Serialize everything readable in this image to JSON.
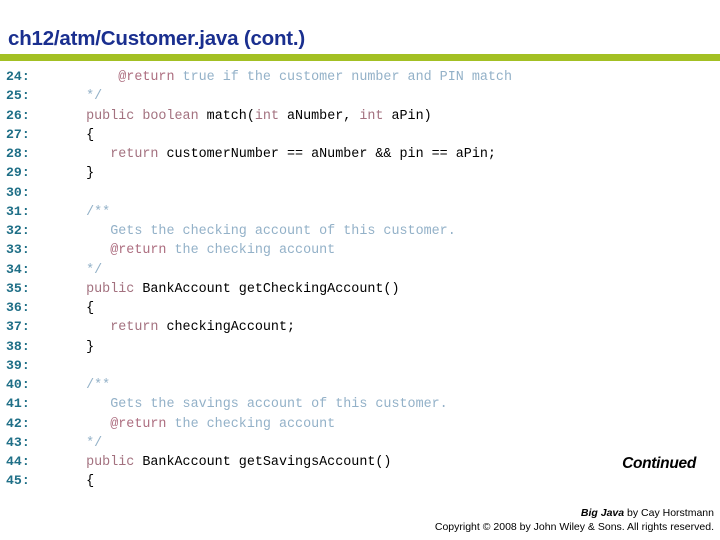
{
  "slide": {
    "title": "ch12/atm/Customer.java  (cont.)",
    "continued_label": "Continued",
    "accent_green": "#a3c023",
    "title_color": "#1a2f8f",
    "line_number_color": "#1f6f87",
    "keyword_color": "#a3717f",
    "comment_color": "#93b1c8",
    "javadoc_tag_color": "#ad6e80"
  },
  "code": {
    "lines": [
      {
        "num": "24:",
        "tokens": [
          {
            "t": "cm",
            "s": "       "
          },
          {
            "t": "tag",
            "s": "@return"
          },
          {
            "t": "cm",
            "s": " true if the customer number and PIN match"
          }
        ]
      },
      {
        "num": "25:",
        "tokens": [
          {
            "t": "cm",
            "s": "   */"
          }
        ]
      },
      {
        "num": "26:",
        "tokens": [
          {
            "t": "kw",
            "s": "   public boolean "
          },
          {
            "t": "src",
            "s": "match("
          },
          {
            "t": "kw",
            "s": "int"
          },
          {
            "t": "src",
            "s": " aNumber, "
          },
          {
            "t": "kw",
            "s": "int"
          },
          {
            "t": "src",
            "s": " aPin)"
          }
        ]
      },
      {
        "num": "27:",
        "tokens": [
          {
            "t": "src",
            "s": "   {"
          }
        ]
      },
      {
        "num": "28:",
        "tokens": [
          {
            "t": "kw",
            "s": "      return "
          },
          {
            "t": "src",
            "s": "customerNumber == aNumber && pin == aPin;"
          }
        ]
      },
      {
        "num": "29:",
        "tokens": [
          {
            "t": "src",
            "s": "   }"
          }
        ]
      },
      {
        "num": "30:",
        "tokens": [
          {
            "t": "src",
            "s": ""
          }
        ]
      },
      {
        "num": "31:",
        "tokens": [
          {
            "t": "cm",
            "s": "   /**"
          }
        ]
      },
      {
        "num": "32:",
        "tokens": [
          {
            "t": "cm",
            "s": "      Gets the checking account of this customer."
          }
        ]
      },
      {
        "num": "33:",
        "tokens": [
          {
            "t": "cm",
            "s": "      "
          },
          {
            "t": "tag",
            "s": "@return"
          },
          {
            "t": "cm",
            "s": " the checking account"
          }
        ]
      },
      {
        "num": "34:",
        "tokens": [
          {
            "t": "cm",
            "s": "   */"
          }
        ]
      },
      {
        "num": "35:",
        "tokens": [
          {
            "t": "kw",
            "s": "   public "
          },
          {
            "t": "src",
            "s": "BankAccount getCheckingAccount()"
          }
        ]
      },
      {
        "num": "36:",
        "tokens": [
          {
            "t": "src",
            "s": "   {"
          }
        ]
      },
      {
        "num": "37:",
        "tokens": [
          {
            "t": "kw",
            "s": "      return "
          },
          {
            "t": "src",
            "s": "checkingAccount;"
          }
        ]
      },
      {
        "num": "38:",
        "tokens": [
          {
            "t": "src",
            "s": "   }"
          }
        ]
      },
      {
        "num": "39:",
        "tokens": [
          {
            "t": "src",
            "s": ""
          }
        ]
      },
      {
        "num": "40:",
        "tokens": [
          {
            "t": "cm",
            "s": "   /**"
          }
        ]
      },
      {
        "num": "41:",
        "tokens": [
          {
            "t": "cm",
            "s": "      Gets the savings account of this customer."
          }
        ]
      },
      {
        "num": "42:",
        "tokens": [
          {
            "t": "cm",
            "s": "      "
          },
          {
            "t": "tag",
            "s": "@return"
          },
          {
            "t": "cm",
            "s": " the checking account"
          }
        ]
      },
      {
        "num": "43:",
        "tokens": [
          {
            "t": "cm",
            "s": "   */"
          }
        ]
      },
      {
        "num": "44:",
        "tokens": [
          {
            "t": "kw",
            "s": "   public "
          },
          {
            "t": "src",
            "s": "BankAccount getSavingsAccount()"
          }
        ]
      },
      {
        "num": "45:",
        "tokens": [
          {
            "t": "src",
            "s": "   {"
          }
        ]
      }
    ]
  },
  "footer": {
    "book_title": "Big Java",
    "byline": " by Cay Horstmann",
    "copyright": "Copyright © 2008 by John Wiley & Sons.  All rights reserved."
  }
}
